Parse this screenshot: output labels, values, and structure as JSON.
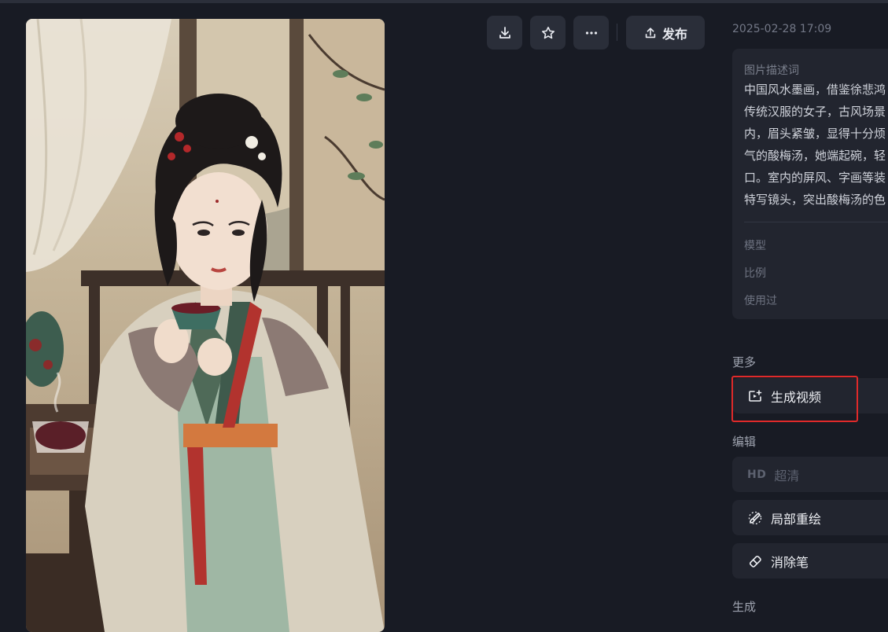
{
  "toolbar": {
    "download_icon": "download-icon",
    "favorite_icon": "star-icon",
    "more_icon": "more-icon",
    "publish_label": "发布"
  },
  "details": {
    "timestamp": "2025-02-28 17:09",
    "description_label": "图片描述词",
    "description_lines": [
      "中国风水墨画，借鉴徐悲鸿",
      "传统汉服的女子，古风场景",
      "内，眉头紧皱，显得十分烦",
      "气的酸梅汤，她端起碗，轻",
      "口。室内的屏风、字画等装",
      "特写镜头，突出酸梅汤的色"
    ],
    "model_label": "模型",
    "ratio_label": "比例",
    "used_label": "使用过"
  },
  "more": {
    "section_label": "更多",
    "generate_video_label": "生成视频"
  },
  "edit": {
    "section_label": "编辑",
    "hd_badge": "HD",
    "upscale_label": "超清",
    "inpaint_label": "局部重绘",
    "eraser_label": "消除笔"
  },
  "generate": {
    "section_label": "生成"
  },
  "colors": {
    "background": "#181b24",
    "card": "#22252f",
    "highlight": "#e02a2a"
  }
}
